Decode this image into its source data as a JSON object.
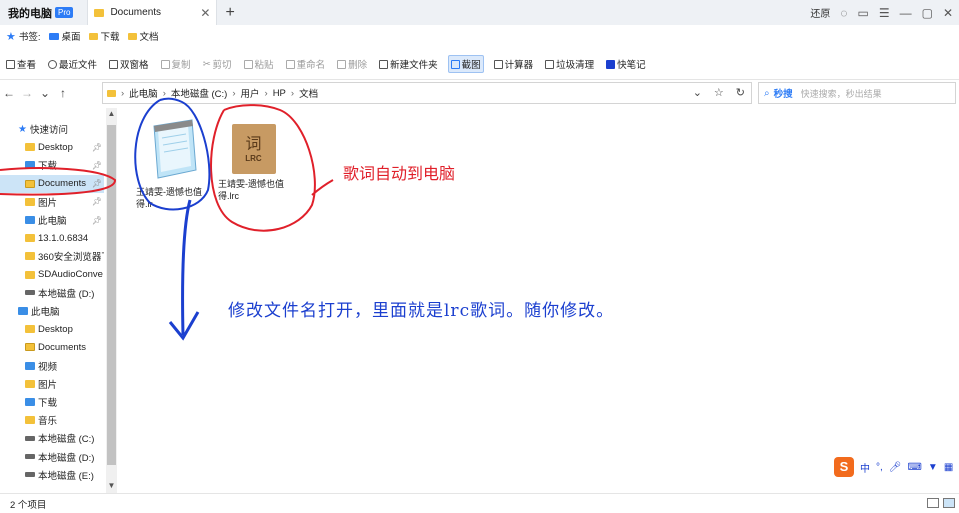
{
  "titlebar": {
    "app_title": "我的电脑",
    "badge": "Pro",
    "tab_label": "Documents",
    "restore_label": "还原"
  },
  "bookmarks": {
    "label": "书签:",
    "items": [
      "桌面",
      "下载",
      "文档"
    ]
  },
  "toolbar": {
    "items": [
      {
        "label": "查看",
        "enabled": true
      },
      {
        "label": "最近文件",
        "enabled": true
      },
      {
        "label": "双窗格",
        "enabled": true
      },
      {
        "label": "复制",
        "enabled": false
      },
      {
        "label": "剪切",
        "enabled": false
      },
      {
        "label": "粘贴",
        "enabled": false
      },
      {
        "label": "重命名",
        "enabled": false
      },
      {
        "label": "删除",
        "enabled": false
      },
      {
        "label": "新建文件夹",
        "enabled": true
      },
      {
        "label": "截图",
        "enabled": true
      },
      {
        "label": "计算器",
        "enabled": true
      },
      {
        "label": "垃圾清理",
        "enabled": true
      },
      {
        "label": "快笔记",
        "enabled": true
      }
    ]
  },
  "address": {
    "crumbs": [
      "此电脑",
      "本地磁盘 (C:)",
      "用户",
      "HP",
      "文档"
    ],
    "search_label": "秒搜",
    "search_placeholder": "快速搜索，秒出结果"
  },
  "sidebar": {
    "items": [
      {
        "label": "快速访问",
        "icon": "star-icon",
        "indent": 1,
        "pinned": false
      },
      {
        "label": "Desktop",
        "icon": "folder-icon",
        "indent": 2,
        "pinned": true
      },
      {
        "label": "下载",
        "icon": "download-icon",
        "indent": 2,
        "pinned": true
      },
      {
        "label": "Documents",
        "icon": "document-icon",
        "indent": 2,
        "pinned": true,
        "selected": true
      },
      {
        "label": "图片",
        "icon": "picture-icon",
        "indent": 2,
        "pinned": true
      },
      {
        "label": "此电脑",
        "icon": "computer-icon",
        "indent": 2,
        "pinned": true
      },
      {
        "label": "13.1.0.6834",
        "icon": "folder-icon",
        "indent": 2,
        "pinned": false
      },
      {
        "label": "360安全浏览器下",
        "icon": "folder-icon",
        "indent": 2,
        "pinned": false
      },
      {
        "label": "SDAudioConve",
        "icon": "folder-icon",
        "indent": 2,
        "pinned": false
      },
      {
        "label": "本地磁盘 (D:)",
        "icon": "disk-icon",
        "indent": 2,
        "pinned": false
      },
      {
        "label": "此电脑",
        "icon": "computer-icon",
        "indent": 1,
        "pinned": false
      },
      {
        "label": "Desktop",
        "icon": "folder-icon",
        "indent": 2,
        "pinned": false
      },
      {
        "label": "Documents",
        "icon": "document-icon",
        "indent": 2,
        "pinned": false
      },
      {
        "label": "视频",
        "icon": "video-icon",
        "indent": 2,
        "pinned": false
      },
      {
        "label": "图片",
        "icon": "picture-icon",
        "indent": 2,
        "pinned": false
      },
      {
        "label": "下载",
        "icon": "download-icon",
        "indent": 2,
        "pinned": false
      },
      {
        "label": "音乐",
        "icon": "music-icon",
        "indent": 2,
        "pinned": false
      },
      {
        "label": "本地磁盘 (C:)",
        "icon": "disk-icon",
        "indent": 2,
        "pinned": false
      },
      {
        "label": "本地磁盘 (D:)",
        "icon": "disk-icon",
        "indent": 2,
        "pinned": false
      },
      {
        "label": "本地磁盘 (E:)",
        "icon": "disk-icon",
        "indent": 2,
        "pinned": false
      }
    ]
  },
  "files": [
    {
      "name": "王靖雯-遗憾也值得.lr",
      "icon": "notepad-icon"
    },
    {
      "name": "王靖雯-遗憾也值得.lrc",
      "icon": "lrc-file-icon",
      "icon_glyph": "词",
      "icon_text": "LRC"
    }
  ],
  "annotations": {
    "red_note": "歌词自动到电脑",
    "blue_note": "修改文件名打开，里面就是lrc歌词。随你修改。",
    "red_color": "#e0202a",
    "blue_color": "#1b3fcf"
  },
  "status": {
    "item_count": "2 个项目"
  },
  "ime": {
    "logo": "S",
    "mode": "中"
  }
}
